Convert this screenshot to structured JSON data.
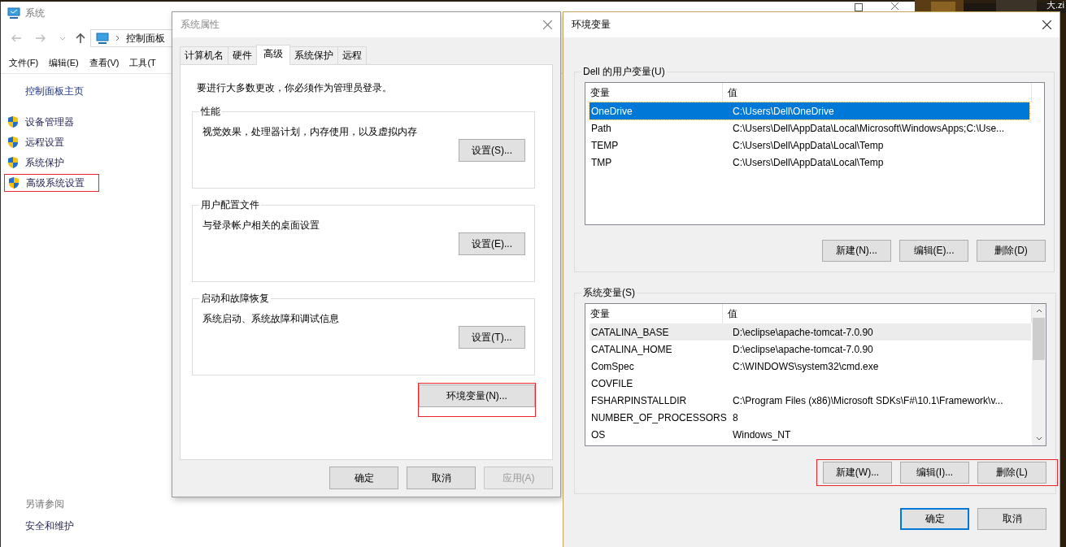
{
  "desktop": {
    "icon_label": "大.zi"
  },
  "system_window": {
    "title": "系统",
    "breadcrumb": [
      "控制面板"
    ],
    "menu": [
      "文件(F)",
      "编辑(E)",
      "查看(V)",
      "工具(T"
    ],
    "sidebar": {
      "home_link": "控制面板主页",
      "items": [
        {
          "label": "设备管理器",
          "marked": false
        },
        {
          "label": "远程设置",
          "marked": false
        },
        {
          "label": "系统保护",
          "marked": false
        },
        {
          "label": "高级系统设置",
          "marked": true
        }
      ],
      "see_also": "另请参阅",
      "see_also_links": [
        "安全和维护"
      ]
    }
  },
  "system_properties": {
    "title": "系统属性",
    "tabs": [
      {
        "label": "计算机名",
        "selected": false
      },
      {
        "label": "硬件",
        "selected": false
      },
      {
        "label": "高级",
        "selected": true
      },
      {
        "label": "系统保护",
        "selected": false
      },
      {
        "label": "远程",
        "selected": false
      }
    ],
    "notice": "要进行大多数更改，你必须作为管理员登录。",
    "groups": [
      {
        "title": "性能",
        "description": "视觉效果，处理器计划，内存使用，以及虚拟内存",
        "button": "设置(S)..."
      },
      {
        "title": "用户配置文件",
        "description": "与登录帐户相关的桌面设置",
        "button": "设置(E)..."
      },
      {
        "title": "启动和故障恢复",
        "description": "系统启动、系统故障和调试信息",
        "button": "设置(T)..."
      }
    ],
    "env_button": {
      "label": "环境变量(N)...",
      "marked": true
    },
    "buttons": [
      {
        "label": "确定",
        "disabled": false
      },
      {
        "label": "取消",
        "disabled": false
      },
      {
        "label": "应用(A)",
        "disabled": true
      }
    ]
  },
  "environment_variables": {
    "title": "环境变量",
    "user_group": {
      "title": "Dell 的用户变量(U)",
      "columns": [
        "变量",
        "值"
      ],
      "rows": [
        {
          "name": "OneDrive",
          "value": "C:\\Users\\Dell\\OneDrive",
          "selected": true,
          "highlighted": false
        },
        {
          "name": "Path",
          "value": "C:\\Users\\Dell\\AppData\\Local\\Microsoft\\WindowsApps;C:\\Use...",
          "selected": false,
          "highlighted": false
        },
        {
          "name": "TEMP",
          "value": "C:\\Users\\Dell\\AppData\\Local\\Temp",
          "selected": false,
          "highlighted": false
        },
        {
          "name": "TMP",
          "value": "C:\\Users\\Dell\\AppData\\Local\\Temp",
          "selected": false,
          "highlighted": false
        }
      ],
      "buttons": [
        "新建(N)...",
        "编辑(E)...",
        "删除(D)"
      ],
      "buttons_marked": false
    },
    "system_group": {
      "title": "系统变量(S)",
      "columns": [
        "变量",
        "值"
      ],
      "rows": [
        {
          "name": "CATALINA_BASE",
          "value": "D:\\eclipse\\apache-tomcat-7.0.90",
          "selected": false,
          "highlighted": true
        },
        {
          "name": "CATALINA_HOME",
          "value": "D:\\eclipse\\apache-tomcat-7.0.90",
          "selected": false,
          "highlighted": false
        },
        {
          "name": "ComSpec",
          "value": "C:\\WINDOWS\\system32\\cmd.exe",
          "selected": false,
          "highlighted": false
        },
        {
          "name": "COVFILE",
          "value": "",
          "selected": false,
          "highlighted": false
        },
        {
          "name": "FSHARPINSTALLDIR",
          "value": "C:\\Program Files (x86)\\Microsoft SDKs\\F#\\10.1\\Framework\\v...",
          "selected": false,
          "highlighted": false
        },
        {
          "name": "NUMBER_OF_PROCESSORS",
          "value": "8",
          "selected": false,
          "highlighted": false
        },
        {
          "name": "OS",
          "value": "Windows_NT",
          "selected": false,
          "highlighted": false
        }
      ],
      "buttons": [
        "新建(W)...",
        "编辑(I)...",
        "删除(L)"
      ],
      "buttons_marked": true
    },
    "buttons": [
      {
        "label": "确定",
        "default": true
      },
      {
        "label": "取消",
        "default": false
      }
    ]
  }
}
